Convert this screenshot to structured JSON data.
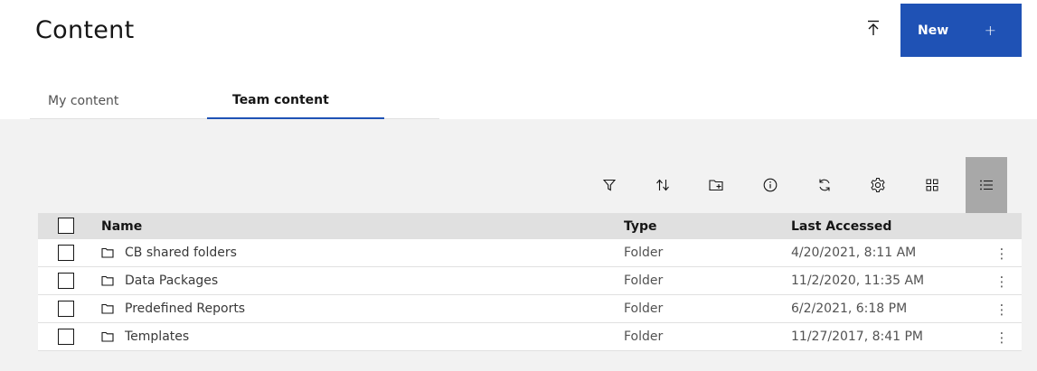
{
  "header": {
    "title": "Content",
    "new_button_label": "New",
    "new_button_plus": "+",
    "upload_icon": "upload-icon"
  },
  "tabs": [
    {
      "label": "My content",
      "selected": false
    },
    {
      "label": "Team content",
      "selected": true
    }
  ],
  "toolbar": {
    "tools": [
      "filter-icon",
      "sort-icon",
      "new-folder-icon",
      "info-icon",
      "refresh-icon",
      "settings-icon",
      "grid-view-icon",
      "list-view-icon"
    ],
    "active_tool": "list-view-icon"
  },
  "table": {
    "columns": [
      "Name",
      "Type",
      "Last Accessed"
    ],
    "rows": [
      {
        "name": "CB shared folders",
        "type": "Folder",
        "last_accessed": "4/20/2021, 8:11 AM"
      },
      {
        "name": "Data Packages",
        "type": "Folder",
        "last_accessed": "11/2/2020, 11:35 AM"
      },
      {
        "name": "Predefined Reports",
        "type": "Folder",
        "last_accessed": "6/2/2021, 6:18 PM"
      },
      {
        "name": "Templates",
        "type": "Folder",
        "last_accessed": "11/27/2017, 8:41 PM"
      }
    ],
    "row_menu_glyph": "⋮"
  },
  "colors": {
    "accent": "#1f52b5",
    "panel_bg": "#f2f2f2",
    "header_bg": "#e0e0e0",
    "active_tool_bg": "#a8a8a8"
  }
}
